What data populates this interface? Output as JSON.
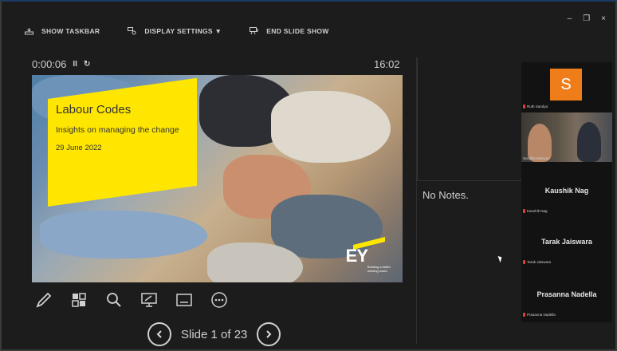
{
  "window": {
    "minimize_glyph": "–",
    "restore_glyph": "❐",
    "close_glyph": "×"
  },
  "toolbar": {
    "show_taskbar": "SHOW TASKBAR",
    "display_settings": "DISPLAY SETTINGS ▼",
    "end_slide_show": "END SLIDE SHOW"
  },
  "timer": {
    "elapsed": "0:00:06",
    "pause_glyph": "II",
    "reset_glyph": "↻",
    "clock": "16:02"
  },
  "slide": {
    "title": "Labour Codes",
    "subtitle": "Insights on managing the change",
    "date": "29 June 2022",
    "logo_text": "EY",
    "logo_tagline": "Building a better working world",
    "accent_color": "#ffe600"
  },
  "tools": [
    "pen-icon",
    "slide-sorter-icon",
    "zoom-icon",
    "pointer-icon",
    "subtitles-icon",
    "more-icon"
  ],
  "navigation": {
    "slide_label": "Slide 1 of 23",
    "prev_glyph": "◀",
    "next_glyph": "▶"
  },
  "notes": {
    "text": "No Notes."
  },
  "participants": [
    {
      "initial": "S",
      "name": "Ruth Sandya",
      "avatar_color": "#ef7e1a"
    },
    {
      "name": "Surabhi Manwan"
    },
    {
      "display": "Kaushik Nag",
      "name": "Kaushik Nag"
    },
    {
      "display": "Tarak Jaiswara",
      "name": "Tarak Jaiswara"
    },
    {
      "display": "Prasanna Nadella",
      "name": "Prasanna Nadella"
    }
  ]
}
